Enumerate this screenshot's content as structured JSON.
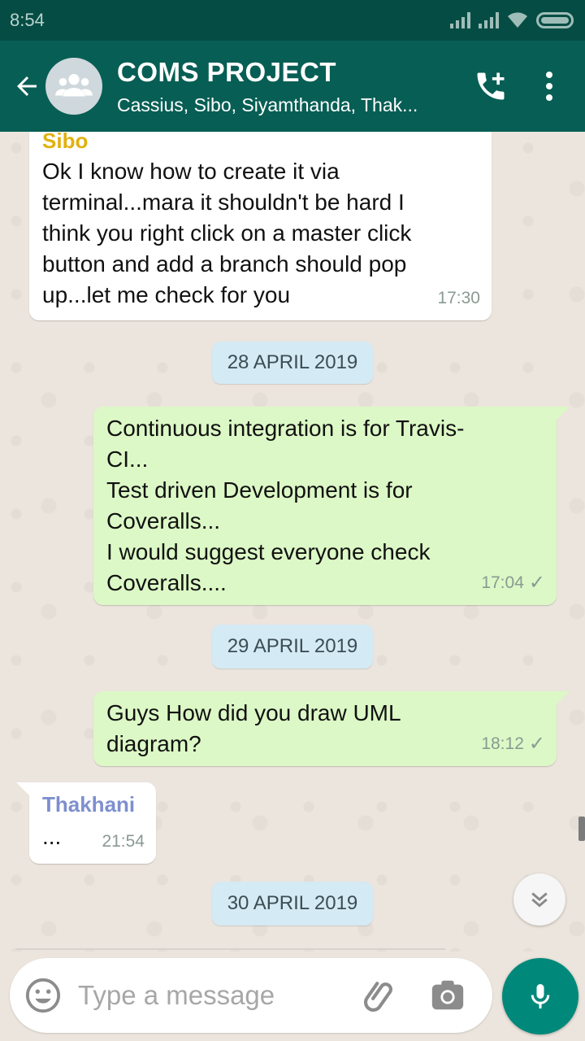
{
  "status_bar": {
    "time": "8:54"
  },
  "header": {
    "title": "COMS PROJECT",
    "subtitle": "Cassius, Sibo, Siyamthanda, Thak..."
  },
  "messages": [
    {
      "type": "incoming",
      "sender": "Sibo",
      "sender_color": "#e1b10f",
      "text": "Ok I know how to create it via\nterminal...mara it shouldn't be hard I\nthink you right click on a master click\nbutton and add a branch should pop\nup...let me check for you",
      "time": "17:30"
    },
    {
      "type": "date",
      "text": "28 APRIL 2019"
    },
    {
      "type": "outgoing",
      "text": "Continuous integration is for Travis-\nCI...\nTest driven Development is for\nCoveralls...\nI would suggest everyone check\nCoveralls....",
      "time": "17:04",
      "status": "✓"
    },
    {
      "type": "date",
      "text": "29 APRIL 2019"
    },
    {
      "type": "outgoing",
      "text": "Guys How did you draw UML\ndiagram?",
      "time": "18:12",
      "status": "✓"
    },
    {
      "type": "incoming",
      "sender": "Thakhani",
      "sender_color": "#7e8fcf",
      "text": "...",
      "time": "21:54"
    },
    {
      "type": "date",
      "text": "30 APRIL 2019"
    }
  ],
  "composer": {
    "placeholder": "Type a message"
  },
  "colors": {
    "header": "#075e54",
    "status_bar": "#054d44",
    "outgoing_bubble": "#dcf8c6",
    "incoming_bubble": "#ffffff",
    "date_chip": "#d4eaf4",
    "accent": "#00897b"
  },
  "icons": {
    "back": "arrow-left-icon",
    "avatar": "group-icon",
    "call": "add-call-icon",
    "menu": "more-vertical-icon",
    "scroll": "double-chevron-down-icon",
    "emoji": "emoji-icon",
    "attach": "paperclip-icon",
    "camera": "camera-icon",
    "mic": "microphone-icon"
  }
}
